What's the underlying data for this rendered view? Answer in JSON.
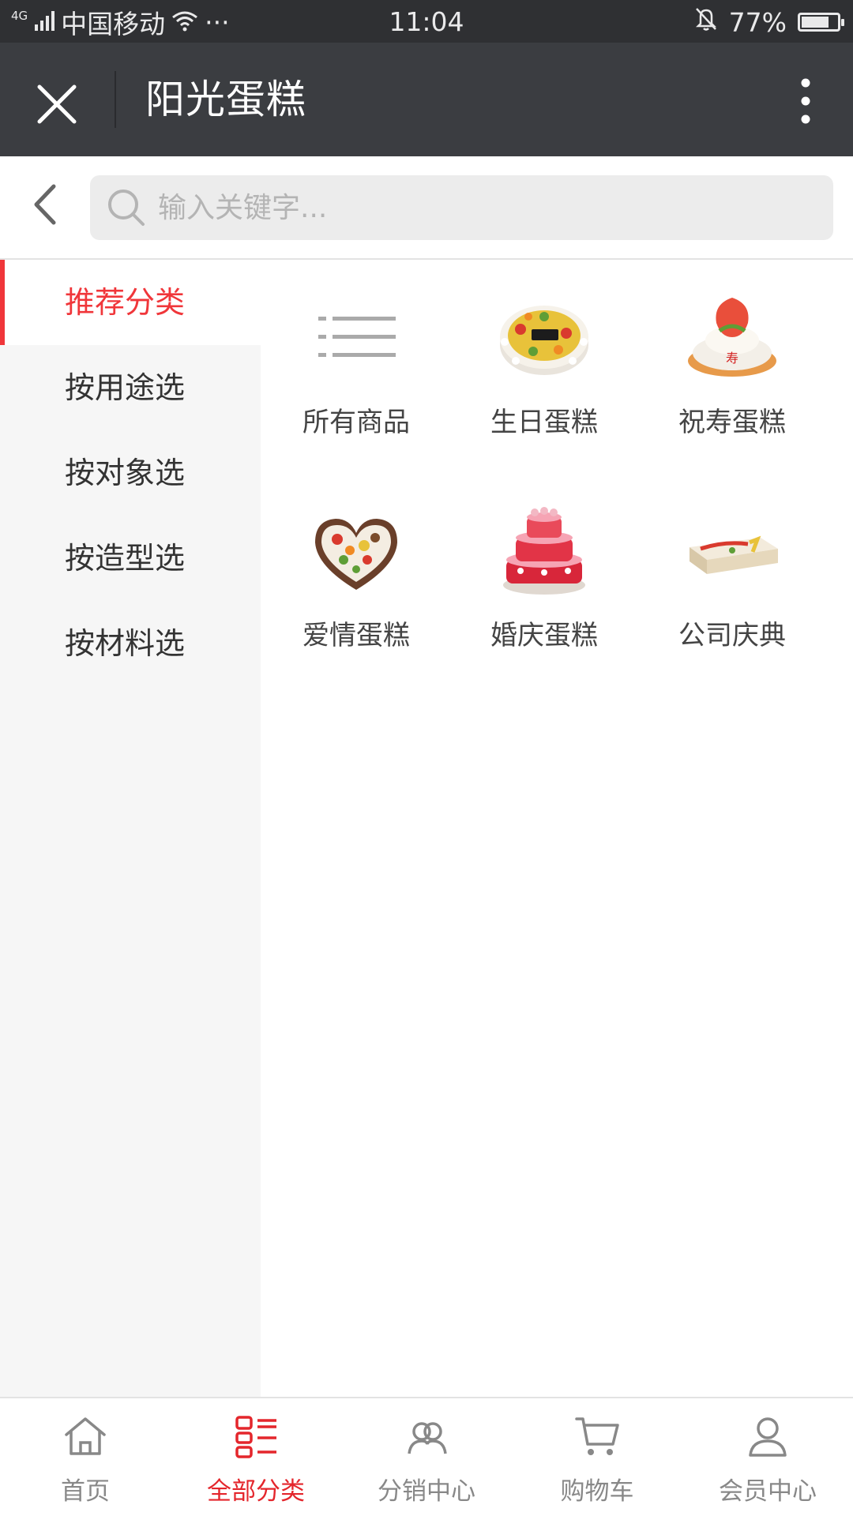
{
  "status_bar": {
    "network": "4G",
    "carrier": "中国移动",
    "dots": "···",
    "time": "11:04",
    "battery": "77%",
    "battery_level": 0.77
  },
  "title_bar": {
    "title": "阳光蛋糕"
  },
  "search": {
    "placeholder": "输入关键字..."
  },
  "sidebar": {
    "items": [
      {
        "label": "推荐分类",
        "active": true
      },
      {
        "label": "按用途选",
        "active": false
      },
      {
        "label": "按对象选",
        "active": false
      },
      {
        "label": "按造型选",
        "active": false
      },
      {
        "label": "按材料选",
        "active": false
      }
    ]
  },
  "grid": {
    "items": [
      {
        "label": "所有商品",
        "icon": "list-icon"
      },
      {
        "label": "生日蛋糕",
        "icon": "birthday-cake-image"
      },
      {
        "label": "祝寿蛋糕",
        "icon": "longevity-cake-image"
      },
      {
        "label": "爱情蛋糕",
        "icon": "heart-cake-image"
      },
      {
        "label": "婚庆蛋糕",
        "icon": "wedding-cake-image"
      },
      {
        "label": "公司庆典",
        "icon": "celebration-cake-image"
      }
    ]
  },
  "tabbar": {
    "items": [
      {
        "label": "首页",
        "icon": "home-icon",
        "active": false
      },
      {
        "label": "全部分类",
        "icon": "category-icon",
        "active": true
      },
      {
        "label": "分销中心",
        "icon": "distribution-icon",
        "active": false
      },
      {
        "label": "购物车",
        "icon": "cart-icon",
        "active": false
      },
      {
        "label": "会员中心",
        "icon": "member-icon",
        "active": false
      }
    ]
  },
  "colors": {
    "accent": "#f0363a",
    "title_bar_bg": "#3b3d41",
    "status_bar_bg": "#2f3033",
    "sidebar_bg": "#f6f6f6"
  }
}
